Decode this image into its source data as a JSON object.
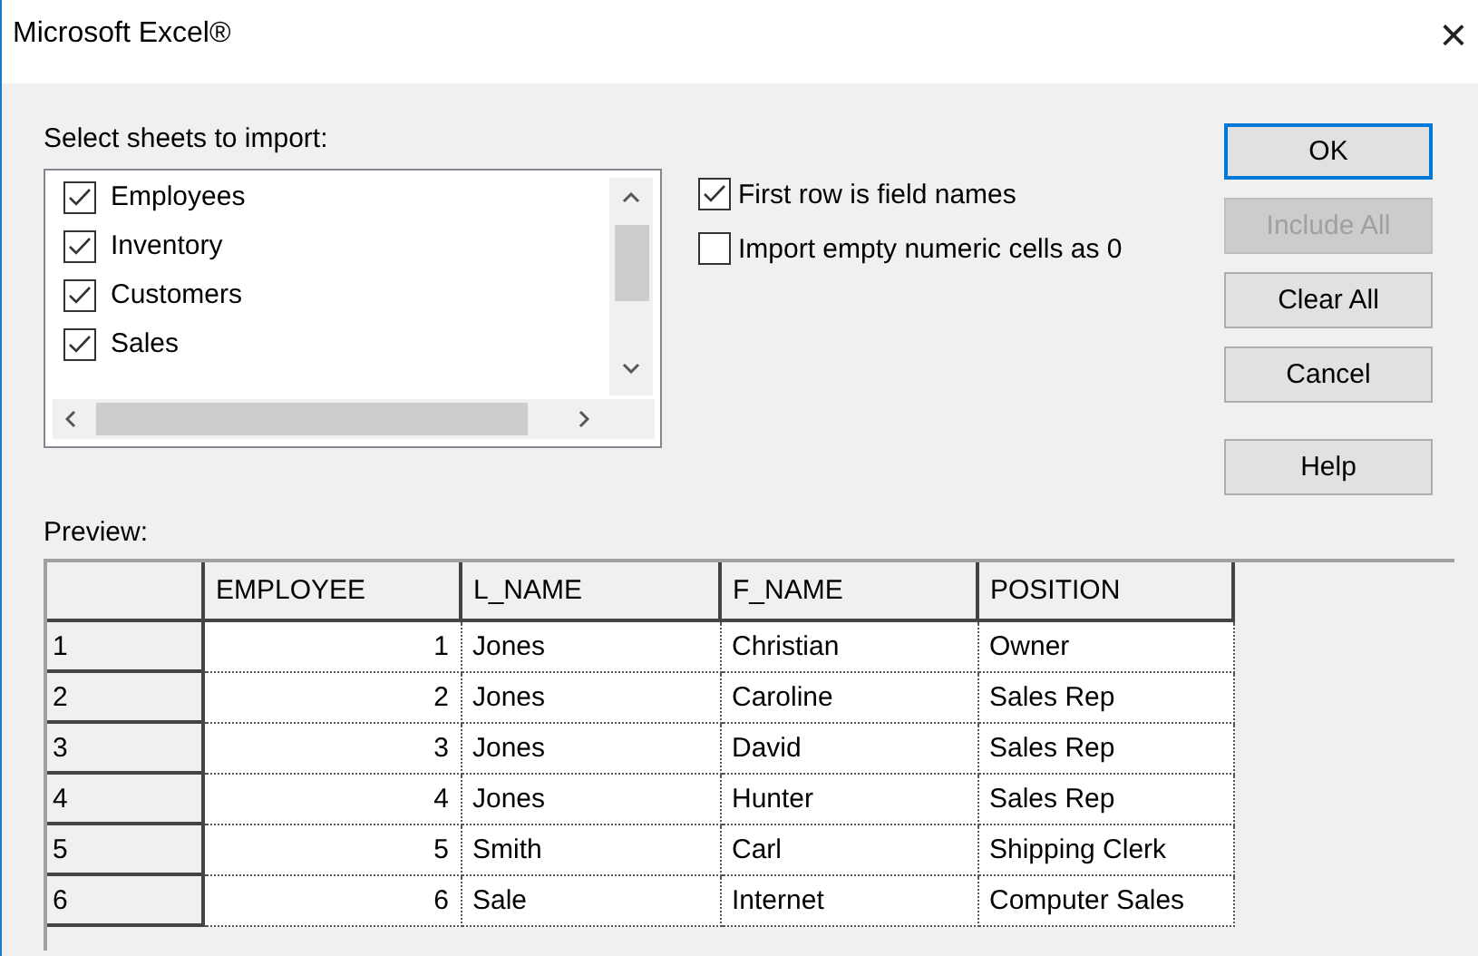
{
  "window": {
    "title": "Microsoft Excel®",
    "close": "×"
  },
  "sheets": {
    "label": "Select sheets to import:",
    "items": [
      {
        "name": "Employees",
        "checked": true
      },
      {
        "name": "Inventory",
        "checked": true
      },
      {
        "name": "Customers",
        "checked": true
      },
      {
        "name": "Sales",
        "checked": true
      }
    ]
  },
  "options": [
    {
      "label": "First row is field names",
      "checked": true
    },
    {
      "label": "Import empty numeric cells as 0",
      "checked": false
    }
  ],
  "buttons": [
    {
      "label": "OK",
      "default": true,
      "disabled": false
    },
    {
      "label": "Include All",
      "default": false,
      "disabled": true
    },
    {
      "label": "Clear All",
      "default": false,
      "disabled": false
    },
    {
      "label": "Cancel",
      "default": false,
      "disabled": false
    },
    {
      "label": "Help",
      "default": false,
      "disabled": false
    }
  ],
  "preview": {
    "label": "Preview:",
    "columns": [
      "EMPLOYEE",
      "L_NAME",
      "F_NAME",
      "POSITION"
    ],
    "rows": [
      {
        "number": "1",
        "cells": [
          "1",
          "Jones",
          "Christian",
          "Owner"
        ]
      },
      {
        "number": "2",
        "cells": [
          "2",
          "Jones",
          "Caroline",
          "Sales Rep"
        ]
      },
      {
        "number": "3",
        "cells": [
          "3",
          "Jones",
          "David",
          "Sales Rep"
        ]
      },
      {
        "number": "4",
        "cells": [
          "4",
          "Jones",
          "Hunter",
          "Sales Rep"
        ]
      },
      {
        "number": "5",
        "cells": [
          "5",
          "Smith",
          "Carl",
          "Shipping Clerk"
        ]
      },
      {
        "number": "6",
        "cells": [
          "6",
          "Sale",
          "Internet",
          "Computer Sales"
        ]
      }
    ]
  }
}
